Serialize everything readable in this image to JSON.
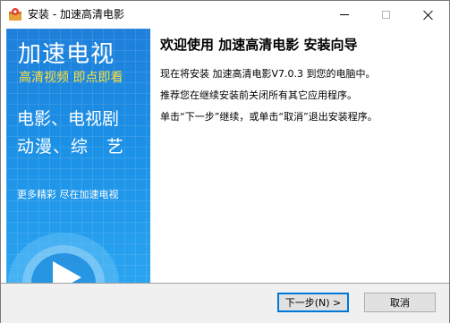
{
  "window": {
    "title": "安装 - 加速高清电影"
  },
  "banner": {
    "title": "加速电视",
    "subtitle": "高清视频 即点即看",
    "line1": "电影、电视剧",
    "line2": "动漫、综　艺",
    "more": "更多精彩 尽在加速电视"
  },
  "content": {
    "heading": "欢迎使用 加速高清电影 安装向导",
    "p1": "现在将安装 加速高清电影V7.0.3 到您的电脑中。",
    "p2": "推荐您在继续安装前关闭所有其它应用程序。",
    "p3": "单击“下一步”继续，或单击“取消”退出安装程序。"
  },
  "buttons": {
    "next": "下一步(N) >",
    "cancel": "取消"
  },
  "icons": {
    "app": "installer-icon",
    "minimize": "minimize-icon",
    "maximize": "maximize-icon",
    "close": "close-icon",
    "play": "play-icon"
  },
  "colors": {
    "banner": "#1b90e6",
    "subtitle": "#ffe23a",
    "accent": "#0078d7"
  }
}
